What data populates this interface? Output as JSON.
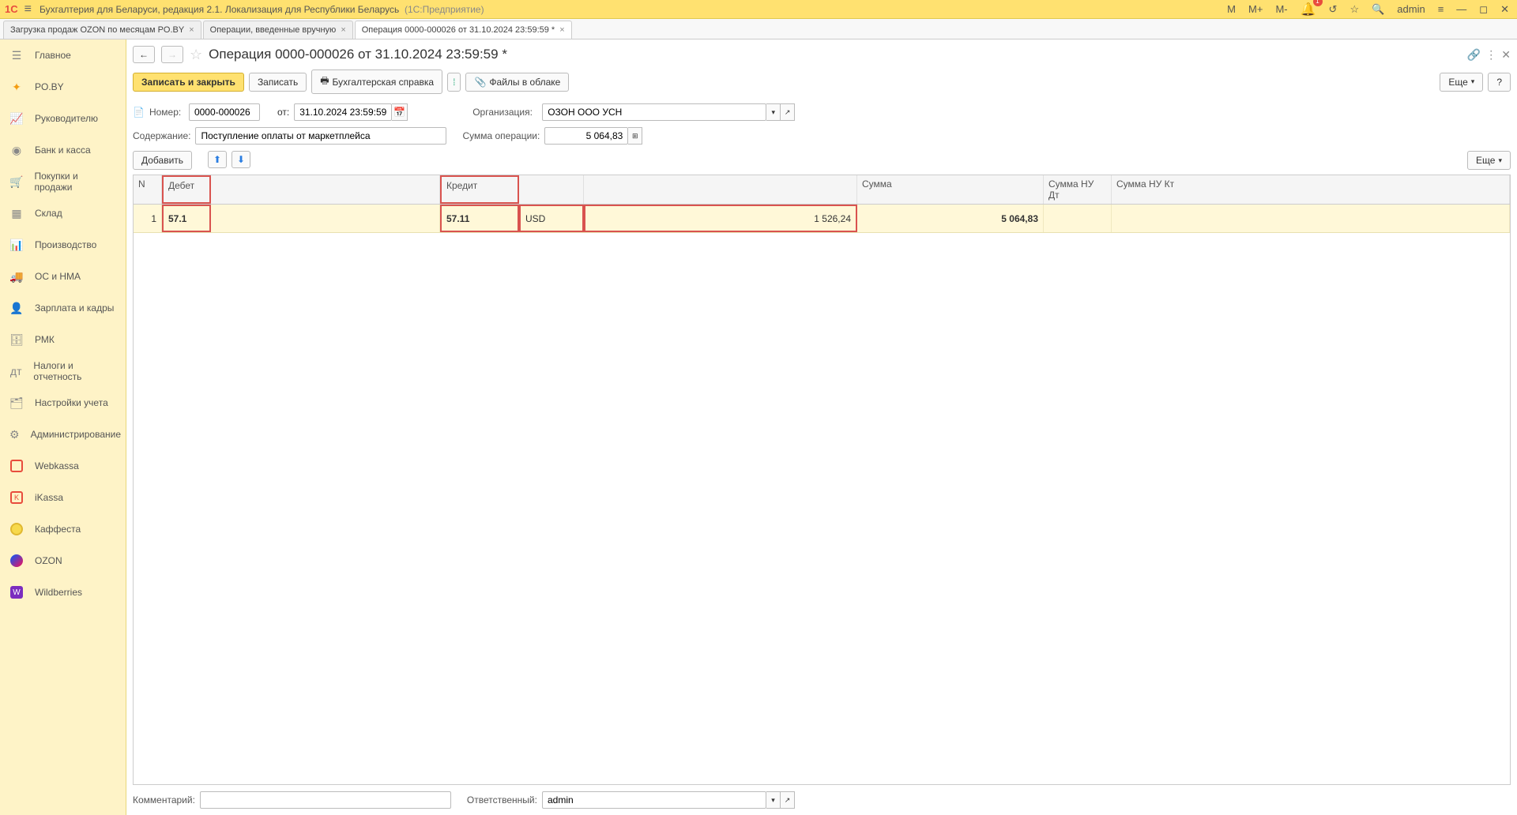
{
  "titlebar": {
    "app_title": "Бухгалтерия для Беларуси, редакция 2.1. Локализация для Республики Беларусь",
    "platform": "(1С:Предприятие)",
    "m": "M",
    "m_plus": "M+",
    "m_minus": "M-",
    "notify_count": "1",
    "user": "admin"
  },
  "tabs": [
    {
      "label": "Загрузка продаж OZON по месяцам PO.BY"
    },
    {
      "label": "Операции, введенные вручную"
    },
    {
      "label": "Операция 0000-000026 от 31.10.2024 23:59:59 *"
    }
  ],
  "sidebar": [
    {
      "label": "Главное"
    },
    {
      "label": "PO.BY"
    },
    {
      "label": "Руководителю"
    },
    {
      "label": "Банк и касса"
    },
    {
      "label": "Покупки и продажи"
    },
    {
      "label": "Склад"
    },
    {
      "label": "Производство"
    },
    {
      "label": "ОС и НМА"
    },
    {
      "label": "Зарплата и кадры"
    },
    {
      "label": "РМК"
    },
    {
      "label": "Налоги и отчетность"
    },
    {
      "label": "Настройки учета"
    },
    {
      "label": "Администрирование"
    },
    {
      "label": "Webkassa"
    },
    {
      "label": "iKassa"
    },
    {
      "label": "Каффеста"
    },
    {
      "label": "OZON"
    },
    {
      "label": "Wildberries"
    }
  ],
  "doc": {
    "title": "Операция 0000-000026 от 31.10.2024 23:59:59 *",
    "save_close": "Записать и закрыть",
    "save": "Записать",
    "ref_report": "Бухгалтерская справка",
    "files_cloud": "Файлы в облаке",
    "more": "Еще",
    "number_label": "Номер:",
    "number": "0000-000026",
    "date_label": "от:",
    "date": "31.10.2024 23:59:59",
    "org_label": "Организация:",
    "org": "ОЗОН ООО УСН",
    "content_label": "Содержание:",
    "content": "Поступление оплаты от маркетплейса",
    "sum_label": "Сумма операции:",
    "sum": "5 064,83",
    "add": "Добавить",
    "comment_label": "Комментарий:",
    "responsible_label": "Ответственный:",
    "responsible": "admin"
  },
  "grid": {
    "headers": {
      "n": "N",
      "debit": "Дебет",
      "credit": "Кредит",
      "sum": "Сумма",
      "nu_dt": "Сумма НУ Дт",
      "nu_kt": "Сумма НУ Кт"
    },
    "row": {
      "n": "1",
      "debit": "57.1",
      "credit": "57.11",
      "cur": "USD",
      "amt2": "1 526,24",
      "sum": "5 064,83"
    }
  }
}
